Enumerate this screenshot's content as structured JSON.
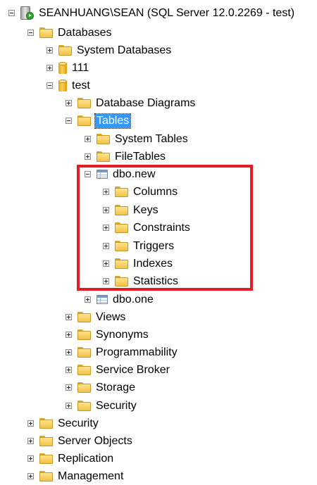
{
  "tree": {
    "server": {
      "label": "SEANHUANG\\SEAN (SQL Server 12.0.2269 - test)",
      "toggle": "minus",
      "icon": "server-icon"
    },
    "databases": {
      "label": "Databases",
      "toggle": "minus",
      "icon": "folder-icon"
    },
    "system_databases": {
      "label": "System Databases",
      "toggle": "plus",
      "icon": "folder-icon"
    },
    "db_111": {
      "label": "111",
      "toggle": "plus",
      "icon": "database-icon"
    },
    "db_test": {
      "label": "test",
      "toggle": "minus",
      "icon": "database-icon"
    },
    "database_diagrams": {
      "label": "Database Diagrams",
      "toggle": "plus",
      "icon": "folder-icon"
    },
    "tables": {
      "label": "Tables",
      "toggle": "minus",
      "icon": "folder-icon",
      "selected": true
    },
    "system_tables": {
      "label": "System Tables",
      "toggle": "plus",
      "icon": "folder-icon"
    },
    "filetables": {
      "label": "FileTables",
      "toggle": "plus",
      "icon": "folder-icon"
    },
    "dbo_new": {
      "label": "dbo.new",
      "toggle": "minus",
      "icon": "table-icon"
    },
    "columns": {
      "label": "Columns",
      "toggle": "plus",
      "icon": "folder-icon"
    },
    "keys": {
      "label": "Keys",
      "toggle": "plus",
      "icon": "folder-icon"
    },
    "constraints": {
      "label": "Constraints",
      "toggle": "plus",
      "icon": "folder-icon"
    },
    "triggers": {
      "label": "Triggers",
      "toggle": "plus",
      "icon": "folder-icon"
    },
    "indexes": {
      "label": "Indexes",
      "toggle": "plus",
      "icon": "folder-icon"
    },
    "statistics": {
      "label": "Statistics",
      "toggle": "plus",
      "icon": "folder-icon"
    },
    "dbo_one": {
      "label": "dbo.one",
      "toggle": "plus",
      "icon": "table-icon"
    },
    "views": {
      "label": "Views",
      "toggle": "plus",
      "icon": "folder-icon"
    },
    "synonyms": {
      "label": "Synonyms",
      "toggle": "plus",
      "icon": "folder-icon"
    },
    "programmability": {
      "label": "Programmability",
      "toggle": "plus",
      "icon": "folder-icon"
    },
    "service_broker": {
      "label": "Service Broker",
      "toggle": "plus",
      "icon": "folder-icon"
    },
    "storage": {
      "label": "Storage",
      "toggle": "plus",
      "icon": "folder-icon"
    },
    "db_security": {
      "label": "Security",
      "toggle": "plus",
      "icon": "folder-icon"
    },
    "server_security": {
      "label": "Security",
      "toggle": "plus",
      "icon": "folder-icon"
    },
    "server_objects": {
      "label": "Server Objects",
      "toggle": "plus",
      "icon": "folder-icon"
    },
    "replication": {
      "label": "Replication",
      "toggle": "plus",
      "icon": "folder-icon"
    },
    "management": {
      "label": "Management",
      "toggle": "plus",
      "icon": "folder-icon"
    }
  },
  "colors": {
    "selection": "#3399ff",
    "highlight_border": "#e31b23",
    "folder": "#f0c24b"
  }
}
